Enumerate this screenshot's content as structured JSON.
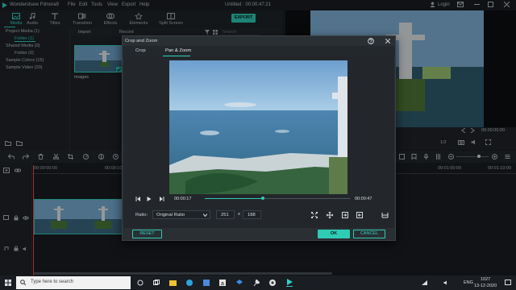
{
  "app": {
    "title": "Wondershare Filmora9",
    "menu": [
      "File",
      "Edit",
      "Tools",
      "View",
      "Export",
      "Help"
    ],
    "project_title": "Untitled : 00:00:47:21",
    "login": "Login"
  },
  "top_tabs": [
    {
      "label": "Media",
      "icon": "media-icon",
      "active": true
    },
    {
      "label": "Audio",
      "icon": "music-note-icon",
      "active": false
    },
    {
      "label": "Titles",
      "icon": "text-icon",
      "active": false
    },
    {
      "label": "Transition",
      "icon": "transition-icon",
      "active": false
    },
    {
      "label": "Effects",
      "icon": "effects-icon",
      "active": false
    },
    {
      "label": "Elements",
      "icon": "elements-icon",
      "active": false
    },
    {
      "label": "Split Screen",
      "icon": "split-screen-icon",
      "active": false
    }
  ],
  "export_label": "EXPORT",
  "media": {
    "import_label": "Import",
    "record_label": "Record",
    "search_placeholder": "Search",
    "folders": [
      {
        "label": "Project Media (1)",
        "selected": false
      },
      {
        "label": "Folder (1)",
        "selected": true
      },
      {
        "label": "Shared Media (0)",
        "selected": false
      },
      {
        "label": "Folder (0)",
        "selected": false
      },
      {
        "label": "Sample Colors (15)",
        "selected": false
      },
      {
        "label": "Sample Video (20)",
        "selected": false
      }
    ],
    "thumb_label": "Images"
  },
  "preview": {
    "timecode": "00:00:00:00",
    "ratio": "1/2"
  },
  "timeline": {
    "start_time": "00:00:00:00",
    "time_mark_1": "00:00:10:00",
    "time_mark_2": "00:01:00:00",
    "time_mark_3": "00:01:10:00"
  },
  "dialog": {
    "title": "Crop and Zoom",
    "tabs": [
      {
        "label": "Crop",
        "active": false
      },
      {
        "label": "Pan & Zoom",
        "active": true
      }
    ],
    "current_time": "00:00:17",
    "total_time": "00:00:47",
    "progress": 0.4,
    "ratio_label": "Ratio:",
    "ratio_value": "Original Ratio",
    "width": "251",
    "times": "x",
    "height": "188",
    "reset_label": "RESET",
    "ok_label": "OK",
    "cancel_label": "CANCEL"
  },
  "taskbar": {
    "search_placeholder": "Type here to search",
    "time": "1027",
    "date": "13-12-2020",
    "lang": "ENG"
  },
  "colors": {
    "accent": "#2fcbb5",
    "dialog_bg": "#2a2f34",
    "panel_bg": "#1f2327"
  }
}
